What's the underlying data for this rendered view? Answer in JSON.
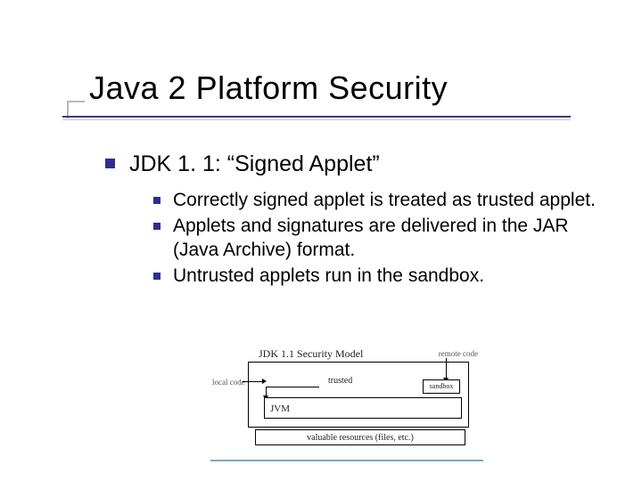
{
  "title": "Java 2 Platform Security",
  "main_point": "JDK 1. 1: “Signed Applet”",
  "sub_points": [
    "Correctly signed applet is treated as trusted applet.",
    "Applets and signatures are delivered in the JAR (Java Archive) format.",
    "Untrusted applets run in the sandbox."
  ],
  "diagram": {
    "caption": "JDK 1.1 Security Model",
    "remote_label": "remote code",
    "local_label": "local code",
    "trusted_label": "trusted",
    "sandbox_label": "sandbox",
    "jvm_label": "JVM",
    "resources_label": "valuable resources (files, etc.)"
  }
}
